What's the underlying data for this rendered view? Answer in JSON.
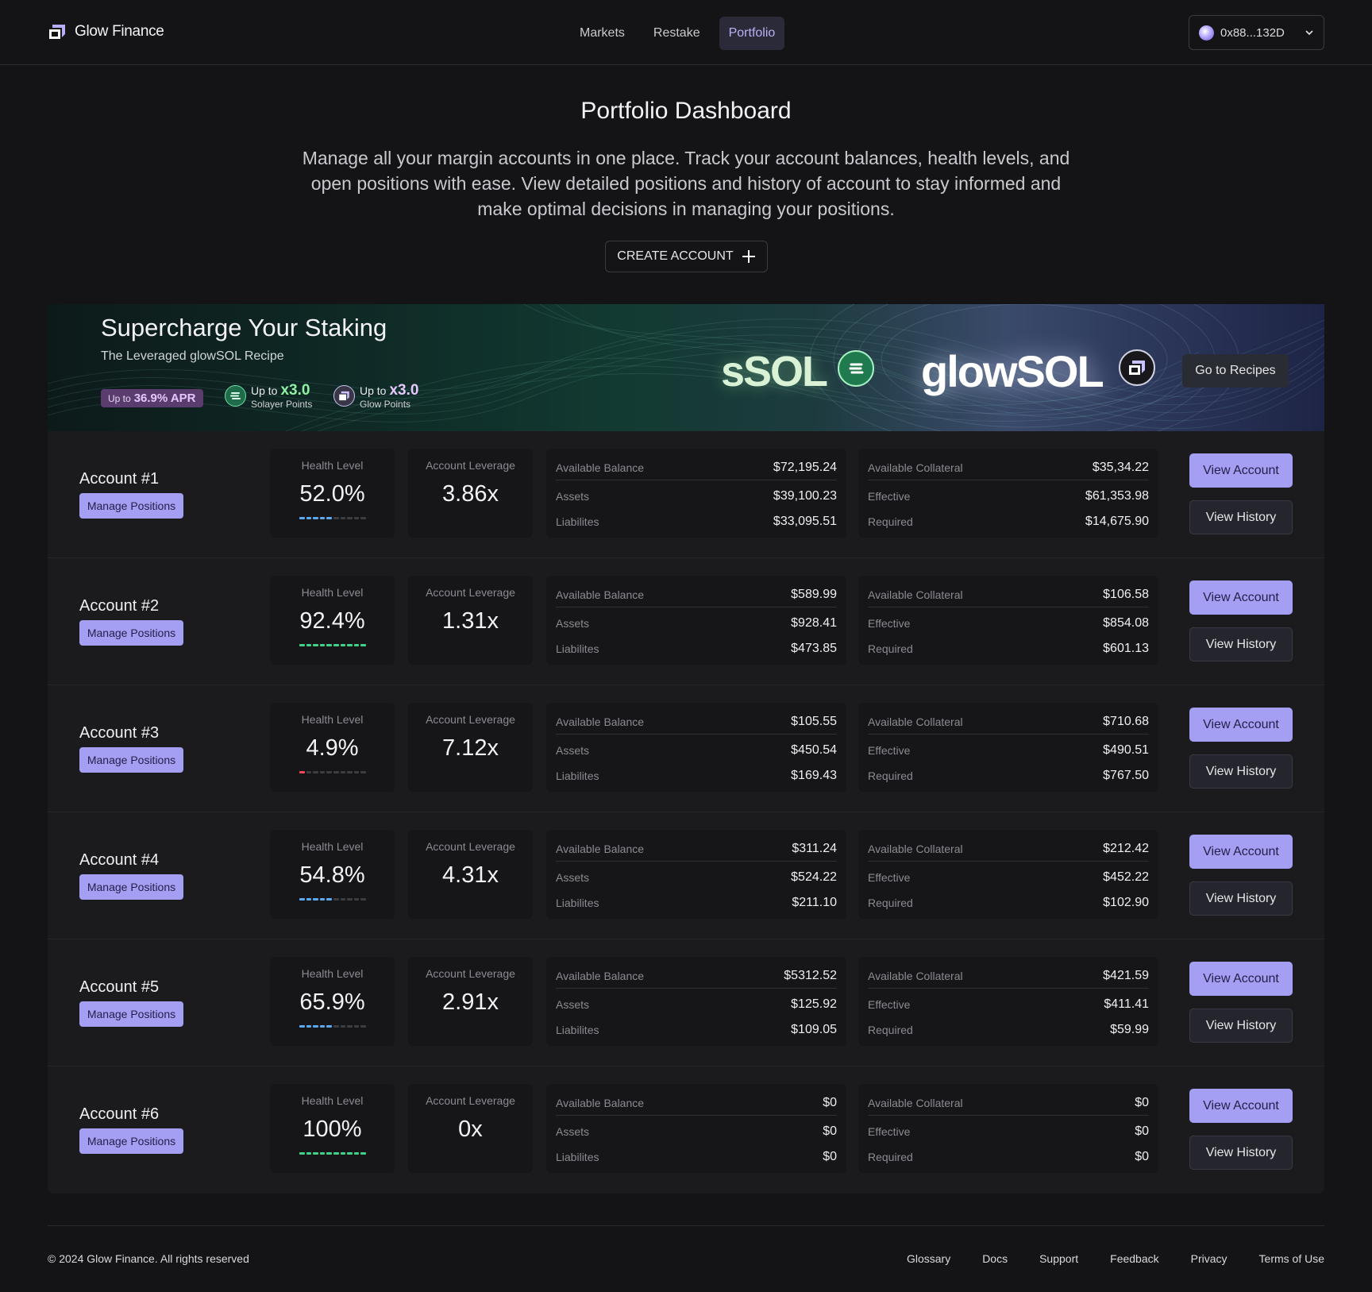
{
  "header": {
    "brand": "Glow Finance",
    "nav": [
      {
        "label": "Markets",
        "active": false
      },
      {
        "label": "Restake",
        "active": false
      },
      {
        "label": "Portfolio",
        "active": true
      }
    ],
    "wallet_address": "0x88...132D"
  },
  "hero": {
    "title": "Portfolio Dashboard",
    "description": "Manage all your margin accounts in one place. Track your account balances, health levels, and open positions with ease. View detailed positions and history of account to stay informed and make optimal decisions in managing your positions.",
    "create_button": "CREATE ACCOUNT"
  },
  "banner": {
    "title": "Supercharge Your Staking",
    "subtitle": "The Leveraged glowSOL Recipe",
    "apr_prefix": "Up to",
    "apr_value": "36.9% APR",
    "solayer": {
      "prefix": "Up to",
      "mult": "x3.0",
      "label": "Solayer Points"
    },
    "glow": {
      "prefix": "Up to",
      "mult": "x3.0",
      "label": "Glow Points"
    },
    "token_a": "sSOL",
    "token_b": "glowSOL",
    "cta": "Go to Recipes"
  },
  "labels": {
    "manage": "Manage Positions",
    "health": "Health Level",
    "leverage": "Account Leverage",
    "available_balance": "Available Balance",
    "assets": "Assets",
    "liabilities": "Liabilites",
    "available_collateral": "Available Collateral",
    "effective": "Effective",
    "required": "Required",
    "view_account": "View Account",
    "view_history": "View History"
  },
  "colors": {
    "accent": "#a49ff3",
    "health_blue": "#5aa8f0",
    "health_green": "#3fd28a",
    "health_red": "#f0455a"
  },
  "accounts": [
    {
      "name": "Account #1",
      "health": "52.0%",
      "health_fraction": 0.52,
      "health_color": "#5aa8f0",
      "leverage": "3.86x",
      "available_balance": "$72,195.24",
      "assets": "$39,100.23",
      "liabilities": "$33,095.51",
      "available_collateral": "$35,34.22",
      "effective": "$61,353.98",
      "required": "$14,675.90"
    },
    {
      "name": "Account #2",
      "health": "92.4%",
      "health_fraction": 1.0,
      "health_color": "#3fd28a",
      "leverage": "1.31x",
      "available_balance": "$589.99",
      "assets": "$928.41",
      "liabilities": "$473.85",
      "available_collateral": "$106.58",
      "effective": "$854.08",
      "required": "$601.13"
    },
    {
      "name": "Account #3",
      "health": "4.9%",
      "health_fraction": 0.1,
      "health_color": "#f0455a",
      "leverage": "7.12x",
      "available_balance": "$105.55",
      "assets": "$450.54",
      "liabilities": "$169.43",
      "available_collateral": "$710.68",
      "effective": "$490.51",
      "required": "$767.50"
    },
    {
      "name": "Account #4",
      "health": "54.8%",
      "health_fraction": 0.5,
      "health_color": "#5aa8f0",
      "leverage": "4.31x",
      "available_balance": "$311.24",
      "assets": "$524.22",
      "liabilities": "$211.10",
      "available_collateral": "$212.42",
      "effective": "$452.22",
      "required": "$102.90"
    },
    {
      "name": "Account #5",
      "health": "65.9%",
      "health_fraction": 0.5,
      "health_color": "#5aa8f0",
      "leverage": "2.91x",
      "available_balance": "$5312.52",
      "assets": "$125.92",
      "liabilities": "$109.05",
      "available_collateral": "$421.59",
      "effective": "$411.41",
      "required": "$59.99"
    },
    {
      "name": "Account #6",
      "health": "100%",
      "health_fraction": 1.0,
      "health_color": "#3fd28a",
      "leverage": "0x",
      "available_balance": "$0",
      "assets": "$0",
      "liabilities": "$0",
      "available_collateral": "$0",
      "effective": "$0",
      "required": "$0"
    }
  ],
  "footer": {
    "copyright": "© 2024 Glow Finance. All rights reserved",
    "links": [
      "Glossary",
      "Docs",
      "Support",
      "Feedback",
      "Privacy",
      "Terms of Use"
    ]
  }
}
